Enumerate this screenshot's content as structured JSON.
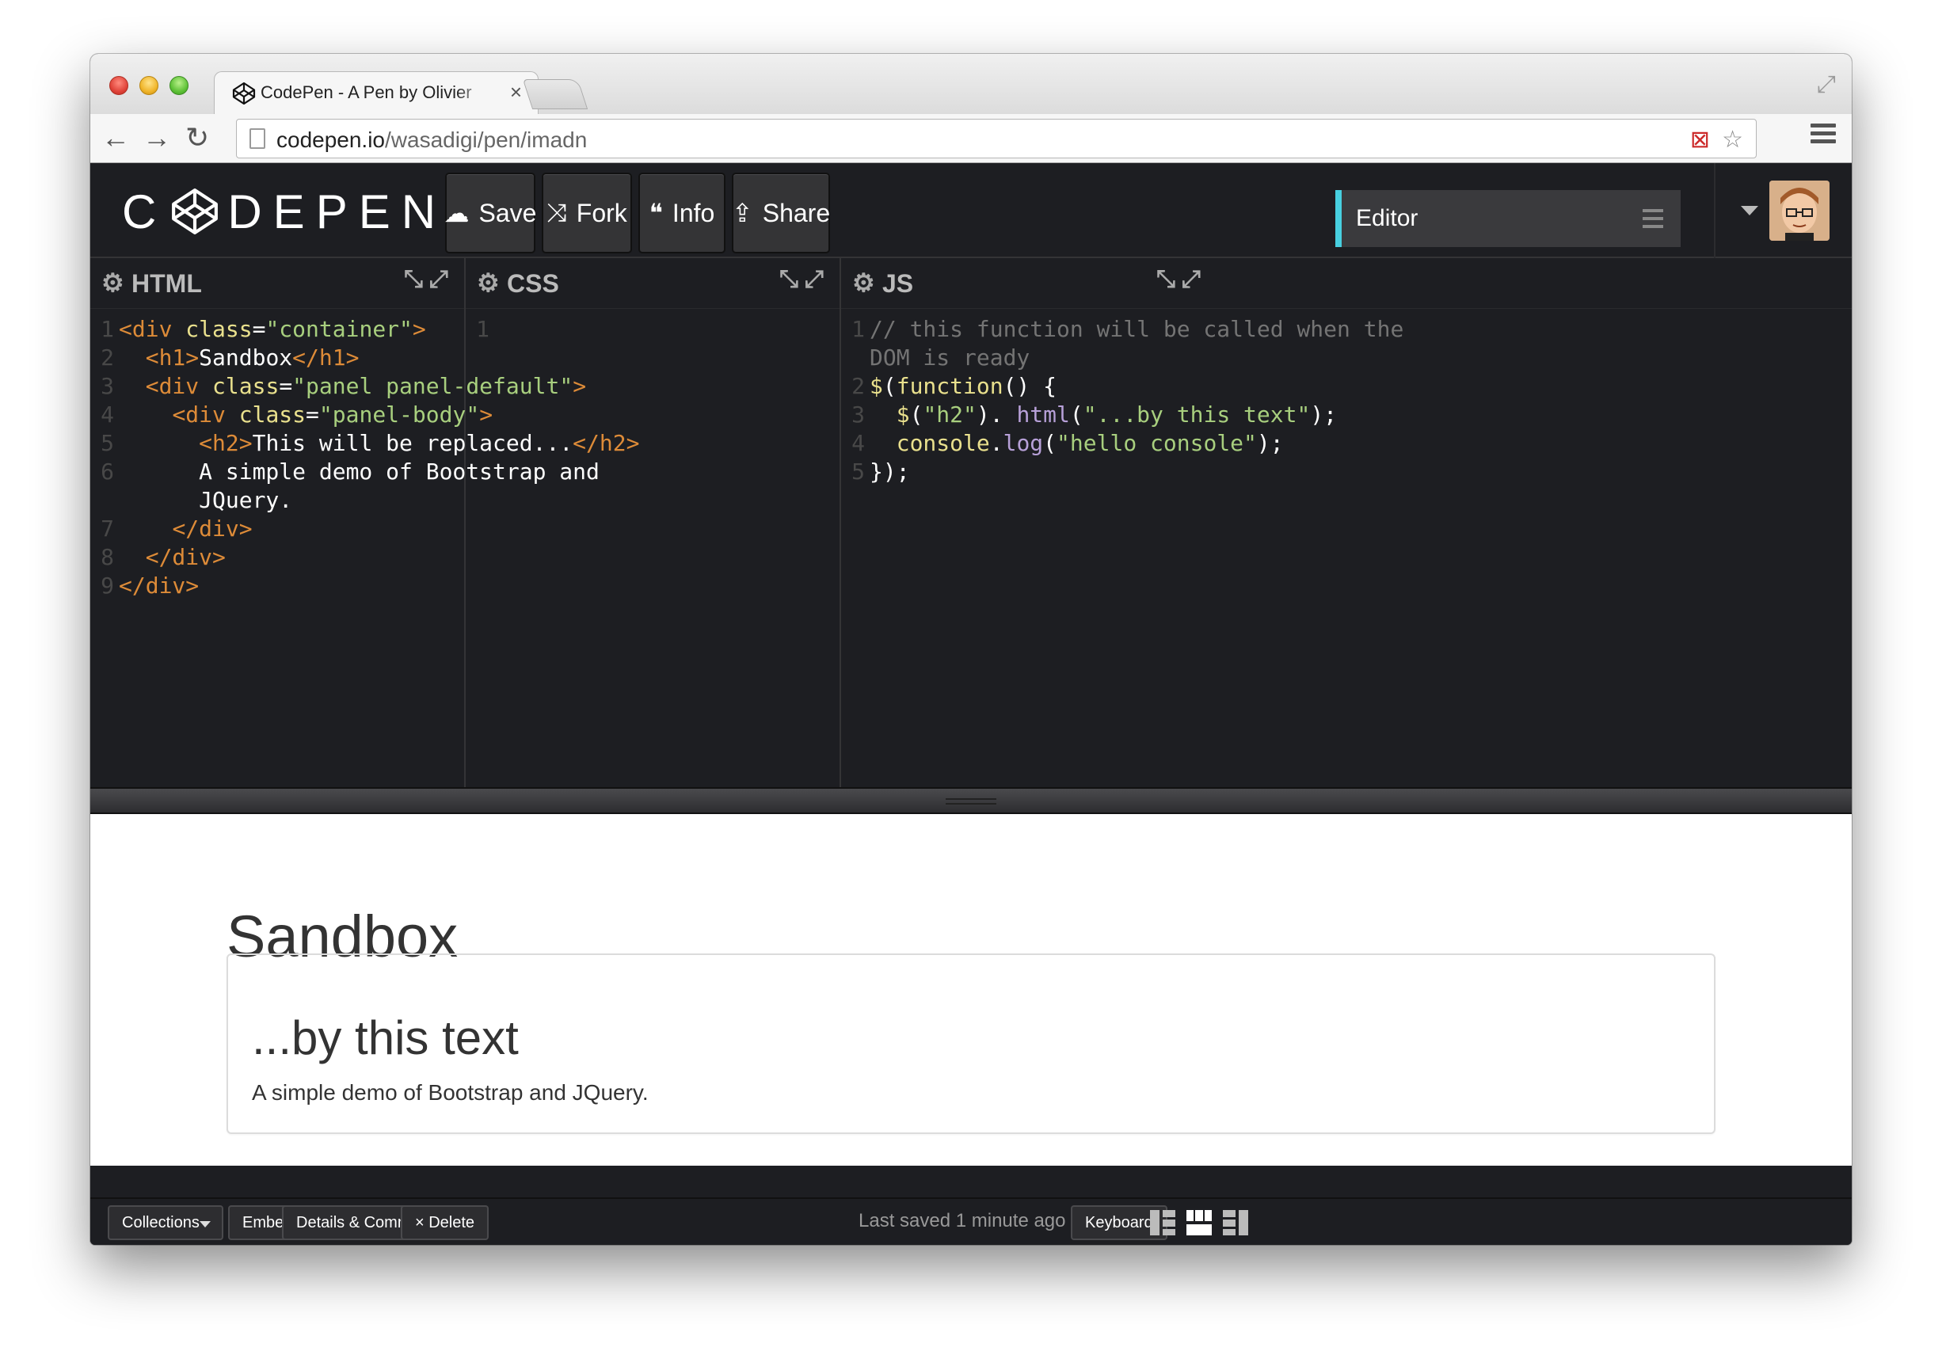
{
  "browser": {
    "tab_title": "CodePen - A Pen by Olivier",
    "url_host": "codepen.io",
    "url_path": "/wasadigi/pen/imadn"
  },
  "header": {
    "logo_text_left": "C",
    "logo_text_right": "DEPEN",
    "buttons": {
      "save": "Save",
      "fork": "Fork",
      "info": "Info",
      "share": "Share"
    },
    "view_select": "Editor"
  },
  "editors": {
    "html": {
      "title": "HTML",
      "lines": [
        {
          "n": "1",
          "segs": [
            [
              "t-tag",
              "<div "
            ],
            [
              "t-attr",
              "class"
            ],
            [
              "",
              "="
            ],
            [
              "t-str",
              "\"container\""
            ],
            [
              "t-tag",
              ">"
            ]
          ]
        },
        {
          "n": "2",
          "segs": [
            [
              "",
              "  "
            ],
            [
              "t-tag",
              "<h1>"
            ],
            [
              "",
              "Sandbox"
            ],
            [
              "t-tag",
              "</h1>"
            ]
          ]
        },
        {
          "n": "3",
          "segs": [
            [
              "",
              "  "
            ],
            [
              "t-tag",
              "<div "
            ],
            [
              "t-attr",
              "class"
            ],
            [
              "",
              "="
            ],
            [
              "t-str",
              "\"panel panel-default\""
            ],
            [
              "t-tag",
              ">"
            ]
          ]
        },
        {
          "n": "4",
          "segs": [
            [
              "",
              "    "
            ],
            [
              "t-tag",
              "<div "
            ],
            [
              "t-attr",
              "class"
            ],
            [
              "",
              "="
            ],
            [
              "t-str",
              "\"panel-body\""
            ],
            [
              "t-tag",
              ">"
            ]
          ]
        },
        {
          "n": "5",
          "segs": [
            [
              "",
              "      "
            ],
            [
              "t-tag",
              "<h2>"
            ],
            [
              "",
              "This will be replaced..."
            ],
            [
              "t-tag",
              "</h2>"
            ]
          ]
        },
        {
          "n": "6",
          "segs": [
            [
              "",
              "      A simple demo of Bootstrap and"
            ]
          ]
        },
        {
          "n": "",
          "segs": [
            [
              "",
              "      JQuery."
            ]
          ]
        },
        {
          "n": "7",
          "segs": [
            [
              "",
              "    "
            ],
            [
              "t-tag",
              "</div>"
            ]
          ]
        },
        {
          "n": "8",
          "segs": [
            [
              "",
              "  "
            ],
            [
              "t-tag",
              "</div>"
            ]
          ]
        },
        {
          "n": "9",
          "segs": [
            [
              "t-tag",
              "</div>"
            ]
          ]
        }
      ]
    },
    "css": {
      "title": "CSS",
      "lines": [
        {
          "n": "1",
          "segs": [
            [
              "",
              ""
            ]
          ]
        }
      ]
    },
    "js": {
      "title": "JS",
      "lines": [
        {
          "n": "1",
          "segs": [
            [
              "t-com",
              "// this function will be called when the"
            ]
          ]
        },
        {
          "n": "",
          "segs": [
            [
              "t-com",
              "DOM is ready"
            ]
          ]
        },
        {
          "n": "2",
          "segs": [
            [
              "t-fn",
              "$"
            ],
            [
              "",
              "("
            ],
            [
              "t-fn",
              "function"
            ],
            [
              "",
              "() {"
            ]
          ]
        },
        {
          "n": "3",
          "segs": [
            [
              "",
              "  "
            ],
            [
              "t-fn",
              "$"
            ],
            [
              "",
              "("
            ],
            [
              "t-str",
              "\"h2\""
            ],
            [
              "",
              "). "
            ],
            [
              "t-prop",
              "html"
            ],
            [
              "",
              "("
            ],
            [
              "t-str",
              "\"...by this text\""
            ],
            [
              "",
              ");"
            ]
          ]
        },
        {
          "n": "4",
          "segs": [
            [
              "",
              "  "
            ],
            [
              "t-fn",
              "console"
            ],
            [
              "",
              "."
            ],
            [
              "t-prop",
              "log"
            ],
            [
              "",
              "("
            ],
            [
              "t-str",
              "\"hello console\""
            ],
            [
              "",
              ");"
            ]
          ]
        },
        {
          "n": "5",
          "segs": [
            [
              "",
              "});"
            ]
          ]
        }
      ]
    }
  },
  "preview": {
    "h1": "Sandbox",
    "h2": "...by this text",
    "p": "A simple demo of Bootstrap and JQuery."
  },
  "footer": {
    "collections": "Collections",
    "embed": "Embed",
    "details": "Details & Comments",
    "delete": "× Delete",
    "status": "Last saved 1 minute ago",
    "keyboard": "Keyboard"
  },
  "colors": {
    "accent": "#47cfe0",
    "editor_bg": "#1d1e22",
    "tag": "#dd8b38",
    "attr": "#e9e08d",
    "string": "#a8cf7e",
    "comment": "#747474"
  }
}
